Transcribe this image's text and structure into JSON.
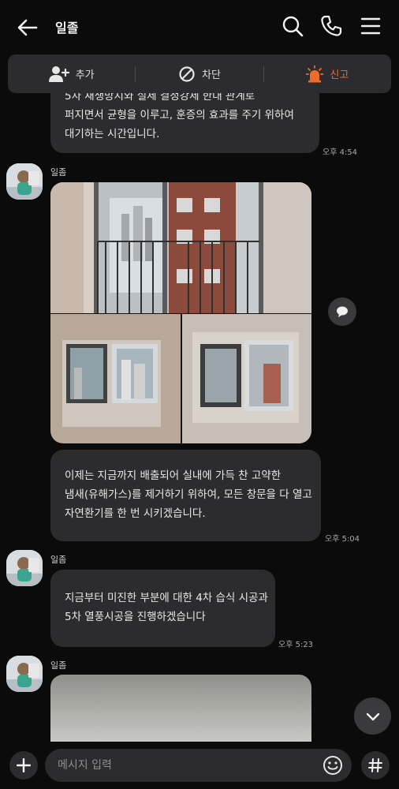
{
  "header": {
    "title": "일졸",
    "back_icon": "arrow-left-icon",
    "search_icon": "search-icon",
    "call_icon": "phone-icon",
    "menu_icon": "hamburger-menu-icon"
  },
  "actions": {
    "add_label": "추가",
    "block_label": "차단",
    "report_label": "신고",
    "report_color": "#f06a2a"
  },
  "messages": {
    "m1": {
      "line1": "5차 재생방지와 실제 결정강제 한대 관계로",
      "line2": "퍼지면서 균형을 이루고, 훈증의 효과를 주기 위하여",
      "line3": "대기하는 시간입니다.",
      "time": "오후 4:54"
    },
    "m2": {
      "sender": "일좀",
      "line1": "이제는 지금까지 배출되어 실내에 가득 찬 고약한",
      "line2": "냄새(유해가스)를 제거하기 위하여, 모든 창문을 다 열고",
      "line3": "자연환기를 한 번 시키겠습니다.",
      "time": "오후 5:04"
    },
    "m3": {
      "sender": "일좀",
      "line1": "지금부터 미진한 부분에 대한 4차 습식 시공과",
      "line2": "5차 열풍시공을 진행하겠습니다",
      "time": "오후 5:23"
    },
    "m4": {
      "sender": "일좀"
    }
  },
  "input": {
    "placeholder": "메시지 입력"
  },
  "colors": {
    "background": "#0b0b0b",
    "bubble": "#2c2c2e",
    "accent_report": "#f06a2a"
  }
}
